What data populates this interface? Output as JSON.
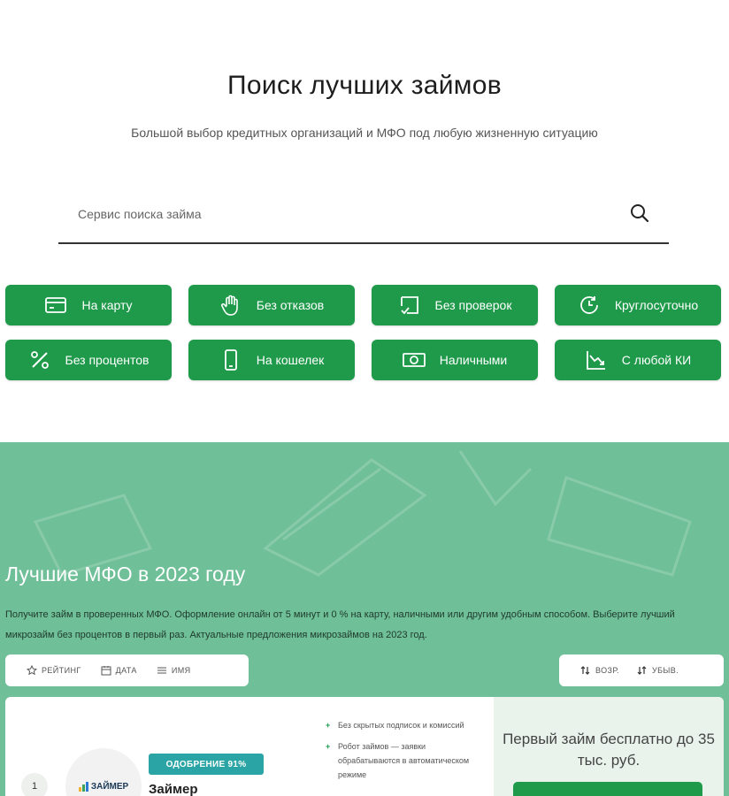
{
  "hero": {
    "title": "Поиск лучших займов",
    "subtitle": "Большой выбор кредитных организаций и МФО под любую жизненную ситуацию"
  },
  "search": {
    "placeholder": "Сервис поиска займа",
    "icon": "search-icon"
  },
  "categories": [
    {
      "label": "На карту",
      "icon": "card-icon"
    },
    {
      "label": "Без отказов",
      "icon": "hand-icon"
    },
    {
      "label": "Без проверок",
      "icon": "check-doc-icon"
    },
    {
      "label": "Круглосуточно",
      "icon": "clock-icon"
    },
    {
      "label": "Без процентов",
      "icon": "percent-icon"
    },
    {
      "label": "На кошелек",
      "icon": "phone-icon"
    },
    {
      "label": "Наличными",
      "icon": "cash-icon"
    },
    {
      "label": "С любой КИ",
      "icon": "chart-down-icon"
    }
  ],
  "mfo": {
    "title": "Лучшие МФО в 2023 году",
    "description": "Получите займ в проверенных МФО. Оформление онлайн от 5 минут и 0 % на карту, наличными или другим удобным способом. Выберите лучший микрозайм без процентов в первый раз. Актуальные предложения микрозаймов на 2023 год."
  },
  "sort": {
    "rating": "РЕЙТИНГ",
    "date": "ДАТА",
    "name": "ИМЯ",
    "asc": "ВОЗР.",
    "desc": "УБЫВ."
  },
  "offer": {
    "rank": "1",
    "logo_text": "ЗАЙМЕР",
    "approval": "ОДОБРЕНИЕ 91%",
    "name": "Займер",
    "features": [
      "Без скрытых подписок и комиссий",
      "Робот займов — заявки обрабатываются в автоматическом режиме"
    ],
    "headline": "Первый займ бесплатно до 35 тыс. руб."
  },
  "colors": {
    "accent": "#1f9a4a",
    "section_bg": "#6fbf98",
    "badge": "#2aa4a4"
  }
}
